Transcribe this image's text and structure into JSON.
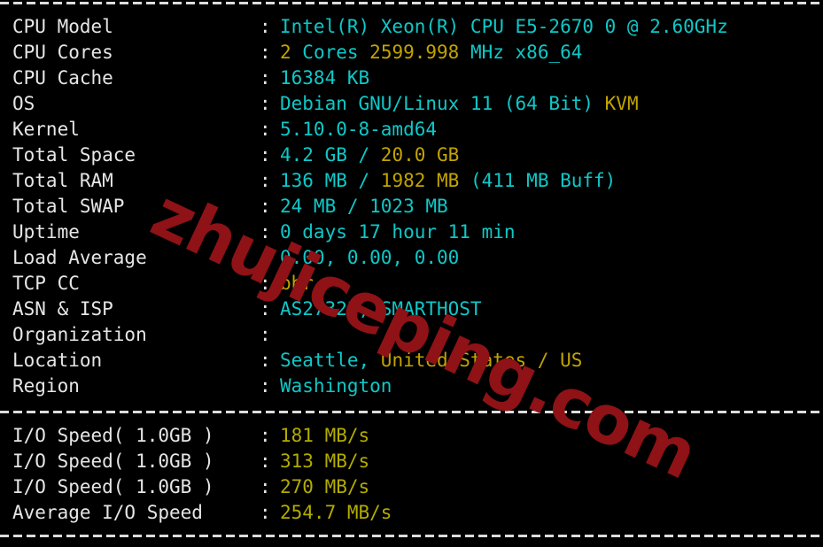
{
  "terminal": {
    "background_color": "#000000",
    "default_text_color": "#e6e6e6",
    "cyan_color": "#0fc8c8",
    "yellow_color": "#c2a400",
    "olive_color": "#b3ac00",
    "separator_glyph": "-"
  },
  "watermark": {
    "text": "zhujiceping.com",
    "color": "#8e1216"
  },
  "separators": {
    "top": "-------------------------------------------------------------------",
    "middle": "-------------------------------------------------------------------",
    "bottom": "-------------------------------------------------------------------"
  },
  "sysinfo": {
    "colon": ":",
    "rows": [
      {
        "label": "CPU Model",
        "value_plain": "Intel(R) Xeon(R) CPU E5-2670 0 @ 2.60GHz",
        "parts": [
          {
            "text": "Intel(R) Xeon(R) CPU E5-2670 0 @ 2.60GHz",
            "color": "cyan"
          }
        ]
      },
      {
        "label": "CPU Cores",
        "value_plain": "2 Cores 2599.998 MHz x86_64",
        "parts": [
          {
            "text": "2",
            "color": "yellow"
          },
          {
            "text": " Cores ",
            "color": "cyan"
          },
          {
            "text": "2599.998",
            "color": "yellow"
          },
          {
            "text": " MHz x86_64",
            "color": "cyan"
          }
        ]
      },
      {
        "label": "CPU Cache",
        "value_plain": "16384 KB",
        "parts": [
          {
            "text": "16384 KB",
            "color": "cyan"
          }
        ]
      },
      {
        "label": "OS",
        "value_plain": "Debian GNU/Linux 11 (64 Bit) KVM",
        "parts": [
          {
            "text": "Debian GNU/Linux 11 (64 Bit) ",
            "color": "cyan"
          },
          {
            "text": "KVM",
            "color": "yellow"
          }
        ]
      },
      {
        "label": "Kernel",
        "value_plain": "5.10.0-8-amd64",
        "parts": [
          {
            "text": "5.10.0-8-amd64",
            "color": "cyan"
          }
        ]
      },
      {
        "label": "Total Space",
        "value_plain": "4.2 GB / 20.0 GB",
        "parts": [
          {
            "text": "4.2 GB / ",
            "color": "cyan"
          },
          {
            "text": "20.0 GB",
            "color": "yellow"
          }
        ]
      },
      {
        "label": "Total RAM",
        "value_plain": "136 MB / 1982 MB (411 MB Buff)",
        "parts": [
          {
            "text": "136 MB / ",
            "color": "cyan"
          },
          {
            "text": "1982 MB",
            "color": "yellow"
          },
          {
            "text": " (411 MB Buff)",
            "color": "cyan"
          }
        ]
      },
      {
        "label": "Total SWAP",
        "value_plain": "24 MB / 1023 MB",
        "parts": [
          {
            "text": "24 MB / 1023 MB",
            "color": "cyan"
          }
        ]
      },
      {
        "label": "Uptime",
        "value_plain": "0 days 17 hour 11 min",
        "parts": [
          {
            "text": "0 days 17 hour 11 min",
            "color": "cyan"
          }
        ]
      },
      {
        "label": "Load Average",
        "value_plain": "0.00, 0.00, 0.00",
        "parts": [
          {
            "text": "0.00, 0.00, 0.00",
            "color": "cyan"
          }
        ]
      },
      {
        "label": "TCP CC",
        "value_plain": "bbr",
        "parts": [
          {
            "text": "bbr",
            "color": "yellow"
          }
        ]
      },
      {
        "label": "ASN & ISP",
        "value_plain": "AS27323, SMARTHOST",
        "parts": [
          {
            "text": "AS27323, SMARTHOST",
            "color": "cyan"
          }
        ]
      },
      {
        "label": "Organization",
        "value_plain": "",
        "parts": []
      },
      {
        "label": "Location",
        "value_plain": "Seattle, United States / US",
        "parts": [
          {
            "text": "Seattle, ",
            "color": "cyan"
          },
          {
            "text": "United States / US",
            "color": "yellow"
          }
        ]
      },
      {
        "label": "Region",
        "value_plain": "Washington",
        "parts": [
          {
            "text": "Washington",
            "color": "cyan"
          }
        ]
      }
    ]
  },
  "iotest": {
    "colon": ":",
    "rows": [
      {
        "label": "I/O Speed( 1.0GB )",
        "value_plain": "181 MB/s",
        "parts": [
          {
            "text": "181 MB/s",
            "color": "olive"
          }
        ]
      },
      {
        "label": "I/O Speed( 1.0GB )",
        "value_plain": "313 MB/s",
        "parts": [
          {
            "text": "313 MB/s",
            "color": "olive"
          }
        ]
      },
      {
        "label": "I/O Speed( 1.0GB )",
        "value_plain": "270 MB/s",
        "parts": [
          {
            "text": "270 MB/s",
            "color": "olive"
          }
        ]
      },
      {
        "label": "Average I/O Speed",
        "value_plain": "254.7 MB/s",
        "parts": [
          {
            "text": "254.7 MB/s",
            "color": "olive"
          }
        ]
      }
    ]
  }
}
